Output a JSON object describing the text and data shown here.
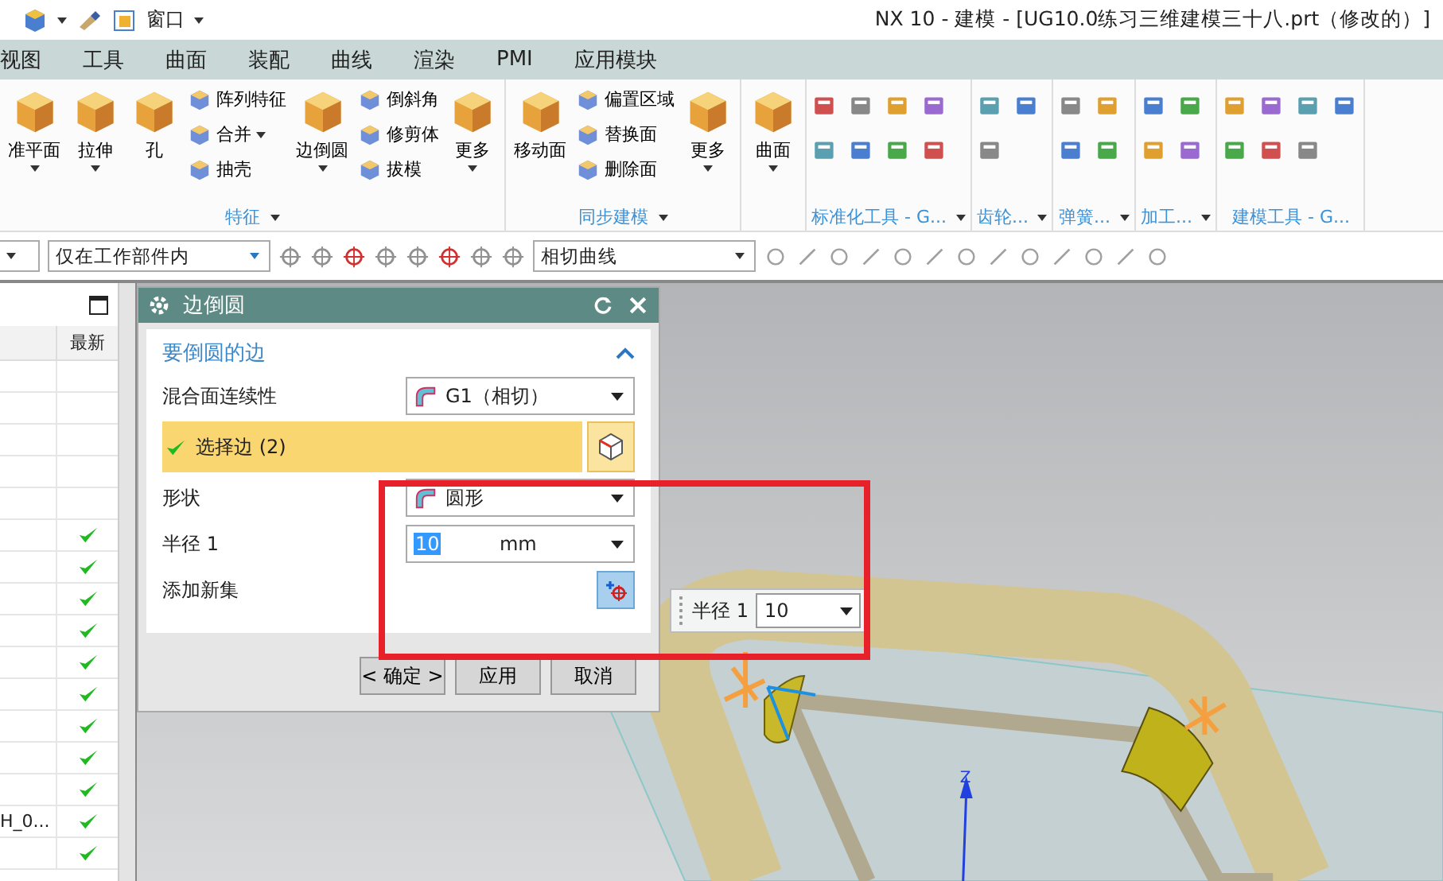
{
  "quick_access": {
    "window_menu": "窗口"
  },
  "window": {
    "title": "NX 10 - 建模 - [UG10.0练习三维建模三十八.prt（修改的）]"
  },
  "menu_tabs": [
    "视图",
    "工具",
    "曲面",
    "装配",
    "曲线",
    "渲染",
    "PMI",
    "应用模块"
  ],
  "ribbon": {
    "groups": [
      {
        "kind": "tools",
        "label": "特征",
        "launcher": true,
        "items": [
          {
            "kind": "large",
            "label": "准平面",
            "dropdown": true
          },
          {
            "kind": "large",
            "label": "拉伸",
            "dropdown": true
          },
          {
            "kind": "large",
            "label": "孔",
            "dropdown": false
          },
          {
            "kind": "stack",
            "items": [
              {
                "label": "阵列特征",
                "dropdown": false
              },
              {
                "label": "合并",
                "dropdown": true
              },
              {
                "label": "抽壳",
                "dropdown": false
              }
            ]
          },
          {
            "kind": "large",
            "label": "边倒圆",
            "dropdown": true
          },
          {
            "kind": "stack",
            "items": [
              {
                "label": "倒斜角",
                "dropdown": false
              },
              {
                "label": "修剪体",
                "dropdown": false
              },
              {
                "label": "拔模",
                "dropdown": false
              }
            ]
          },
          {
            "kind": "large",
            "label": "更多",
            "dropdown": true
          }
        ]
      },
      {
        "kind": "tools",
        "label": "同步建模",
        "launcher": true,
        "items": [
          {
            "kind": "large",
            "label": "移动面",
            "dropdown": false
          },
          {
            "kind": "stack",
            "items": [
              {
                "label": "偏置区域",
                "dropdown": false
              },
              {
                "label": "替换面",
                "dropdown": false
              },
              {
                "label": "删除面",
                "dropdown": false
              }
            ]
          },
          {
            "kind": "large",
            "label": "更多",
            "dropdown": true
          }
        ]
      },
      {
        "kind": "tools",
        "items": [
          {
            "kind": "large",
            "label": "曲面",
            "dropdown": true
          }
        ]
      },
      {
        "kind": "icons",
        "label": "标准化工具 - G...",
        "launcher": true
      },
      {
        "kind": "icons",
        "label": "齿轮...",
        "launcher": true
      },
      {
        "kind": "icons",
        "label": "弹簧...",
        "launcher": true
      },
      {
        "kind": "icons",
        "label": "加工...",
        "launcher": true
      },
      {
        "kind": "icons",
        "label": "建模工具 - G...",
        "launcher": false
      }
    ]
  },
  "selection_bar": {
    "scope": "仅在工作部件内",
    "curve_rule": "相切曲线"
  },
  "part_navigator": {
    "column": "最新",
    "rows": [
      {
        "latest": false
      },
      {
        "latest": false
      },
      {
        "latest": false
      },
      {
        "latest": false
      },
      {
        "latest": false
      },
      {
        "latest": true
      },
      {
        "latest": true
      },
      {
        "latest": true
      },
      {
        "latest": true
      },
      {
        "latest": true
      },
      {
        "latest": true
      },
      {
        "latest": true
      },
      {
        "latest": true
      },
      {
        "latest": true
      },
      {
        "name": "H_0...",
        "latest": true
      },
      {
        "latest": true
      }
    ]
  },
  "dialog": {
    "title": "边倒圆",
    "section": {
      "title": "要倒圆的边",
      "expanded": true
    },
    "fields": [
      {
        "kind": "dropdown",
        "label": "混合面连续性",
        "value": "G1（相切）"
      },
      {
        "kind": "selection",
        "label": "选择边 (2)",
        "selected": true
      },
      {
        "kind": "dropdown",
        "label": "形状",
        "value": "圆形"
      },
      {
        "kind": "number",
        "label": "半径 1",
        "value": "10",
        "unit": "mm"
      },
      {
        "kind": "button",
        "label": "添加新集"
      }
    ],
    "buttons": [
      "< 确定 >",
      "应用",
      "取消"
    ]
  },
  "viewport": {
    "radius_widget": {
      "label": "半径 1",
      "value": "10"
    },
    "axis_label": "Z"
  }
}
